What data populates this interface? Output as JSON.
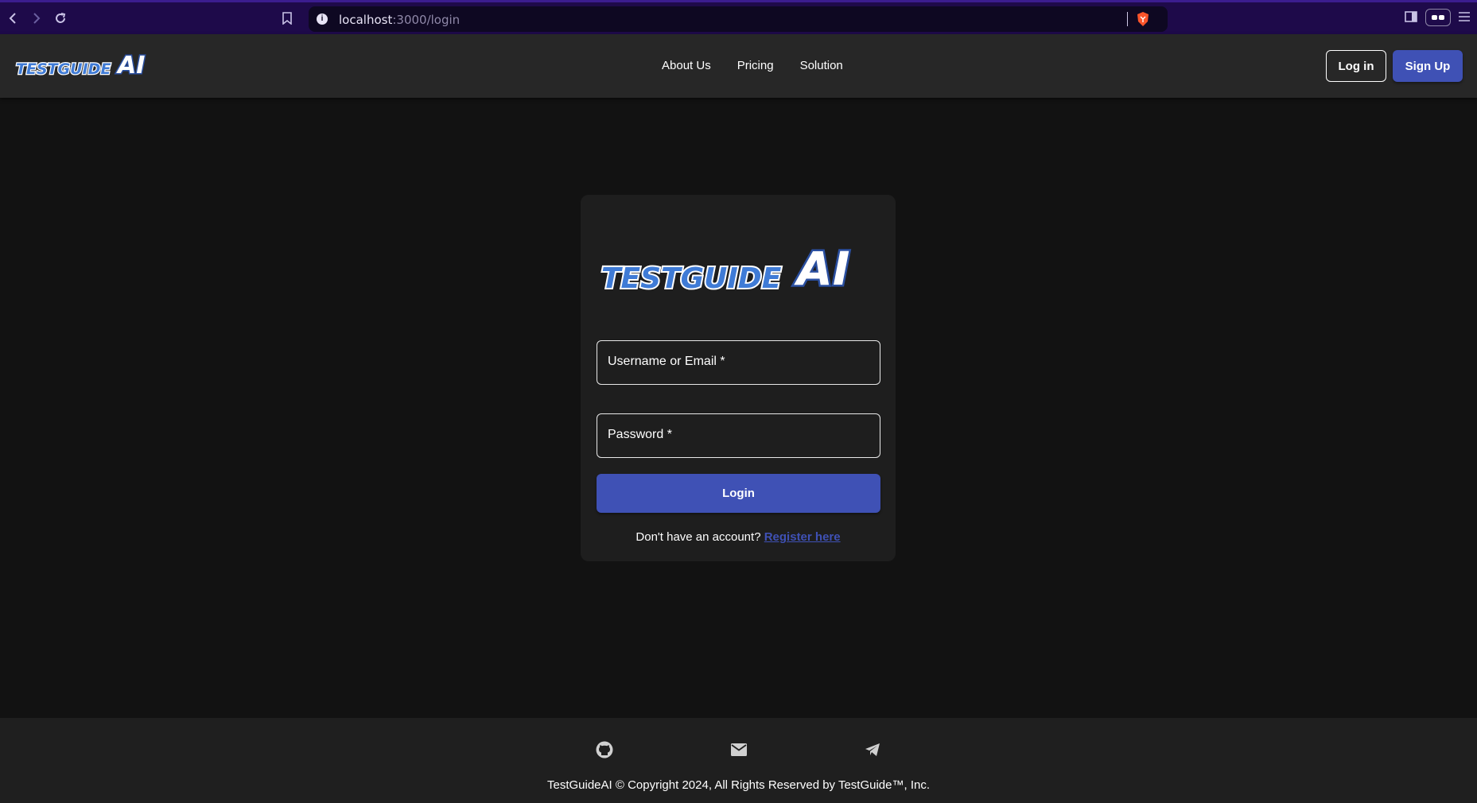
{
  "browser": {
    "url_host": "localhost",
    "url_path": ":3000/login"
  },
  "header": {
    "logo_alt": "TestGuideAI",
    "nav": {
      "about": "About Us",
      "pricing": "Pricing",
      "solution": "Solution"
    },
    "login_label": "Log in",
    "signup_label": "Sign Up"
  },
  "login_form": {
    "username_label": "Username or Email",
    "username_required": "*",
    "password_label": "Password",
    "password_required": "*",
    "submit_label": "Login",
    "register_prompt": "Don't have an account?",
    "register_link": "Register here"
  },
  "footer": {
    "icons": [
      "github-icon",
      "email-icon",
      "telegram-icon"
    ],
    "copyright": "TestGuideAI © Copyright 2024, All Rights Reserved by TestGuide™, Inc."
  },
  "colors": {
    "accent": "#3f51b5",
    "background": "#121212",
    "header": "#272727",
    "card": "#1e1e1e",
    "browser_bar": "#1e0a4a"
  }
}
